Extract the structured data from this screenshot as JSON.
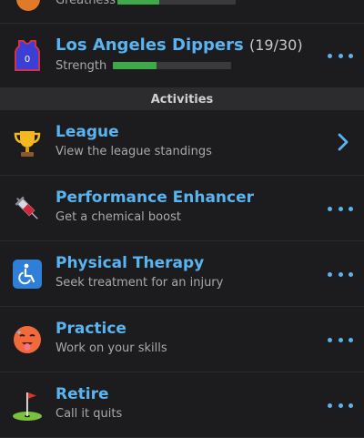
{
  "top_stat": {
    "label": "Greatness",
    "fraction": 0.35
  },
  "team": {
    "name": "Los Angeles Dippers",
    "record": "(19/30)",
    "stat_label": "Strength",
    "fraction": 0.37,
    "jersey_number": "0",
    "icon": "jersey-icon"
  },
  "section_title": "Activities",
  "activities": [
    {
      "title": "League",
      "subtitle": "View the league standings",
      "icon": "trophy-icon",
      "action": "chevron"
    },
    {
      "title": "Performance Enhancer",
      "subtitle": "Get a chemical boost",
      "icon": "syringe-icon",
      "action": "more"
    },
    {
      "title": "Physical Therapy",
      "subtitle": "Seek treatment for an injury",
      "icon": "wheelchair-icon",
      "action": "more"
    },
    {
      "title": "Practice",
      "subtitle": "Work on your skills",
      "icon": "hot-face-icon",
      "action": "more"
    },
    {
      "title": "Retire",
      "subtitle": "Call it quits",
      "icon": "golf-flag-icon",
      "action": "more"
    }
  ],
  "colors": {
    "accent": "#5ab4f0",
    "bar_fill": "#3fa94a",
    "background": "#1c1c1e"
  }
}
